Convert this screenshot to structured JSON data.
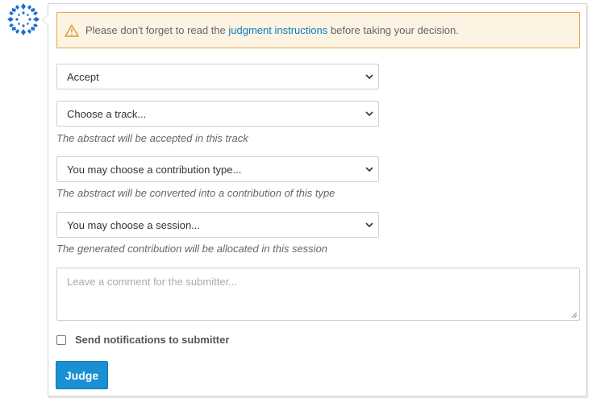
{
  "warning": {
    "text_before": "Please don't forget to read the",
    "link": "judgment instructions",
    "text_after": "before taking your decision."
  },
  "judgment_select": {
    "value": "Accept"
  },
  "track_select": {
    "value": "Choose a track...",
    "help": "The abstract will be accepted in this track"
  },
  "contribution_type_select": {
    "value": "You may choose a contribution type...",
    "help": "The abstract will be converted into a contribution of this type"
  },
  "session_select": {
    "value": "You may choose a session...",
    "help": "The generated contribution will be allocated in this session"
  },
  "comment": {
    "placeholder": "Leave a comment for the submitter..."
  },
  "notify": {
    "label": "Send notifications to submitter",
    "checked": false
  },
  "submit": {
    "label": "Judge"
  },
  "colors": {
    "warning_bg": "#fcf3e3",
    "warning_border": "#e5a64b",
    "link": "#0c7dbd",
    "button": "#1a8fd1",
    "avatar": "#1a6fcf"
  }
}
